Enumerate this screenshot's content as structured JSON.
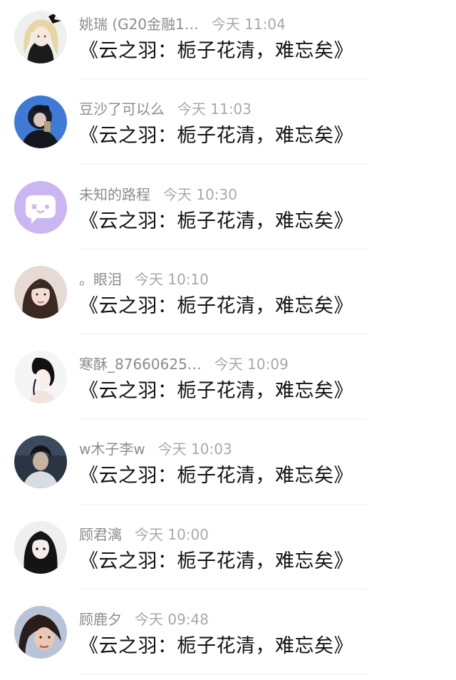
{
  "messages": [
    {
      "name": "姚瑞 (G20金融1…",
      "time": "今天 11:04",
      "text": "《云之羽：栀子花清，难忘矣》",
      "avatar": "avatar-blonde-doll"
    },
    {
      "name": "豆沙了可以么",
      "time": "今天 11:03",
      "text": "《云之羽：栀子花清，难忘矣》",
      "avatar": "avatar-selfie-phone"
    },
    {
      "name": "未知的路程",
      "time": "今天 10:30",
      "text": "《云之羽：栀子花清，难忘矣》",
      "avatar": "avatar-default-chat"
    },
    {
      "name": "。眼泪",
      "time": "今天 10:10",
      "text": "《云之羽：栀子花清，难忘矣》",
      "avatar": "avatar-girl-portrait"
    },
    {
      "name": "寒酥_87660625…",
      "time": "今天 10:09",
      "text": "《云之羽：栀子花清，难忘矣》",
      "avatar": "avatar-girl-sketch"
    },
    {
      "name": "w木子李w",
      "time": "今天 10:03",
      "text": "《云之羽：栀子花清，难忘矣》",
      "avatar": "avatar-boy-night"
    },
    {
      "name": "顾君漓",
      "time": "今天 10:00",
      "text": "《云之羽：栀子花清，难忘矣》",
      "avatar": "avatar-anime-girl"
    },
    {
      "name": "顾鹿夕",
      "time": "今天 09:48",
      "text": "《云之羽：栀子花清，难忘矣》",
      "avatar": "avatar-girl-closeup"
    }
  ],
  "colors": {
    "name_text": "#8c8c8c",
    "time_text": "#a8a8a8",
    "message_text": "#111111",
    "default_avatar_bg": "#c9b6f2",
    "divider": "#f0f0f0"
  }
}
